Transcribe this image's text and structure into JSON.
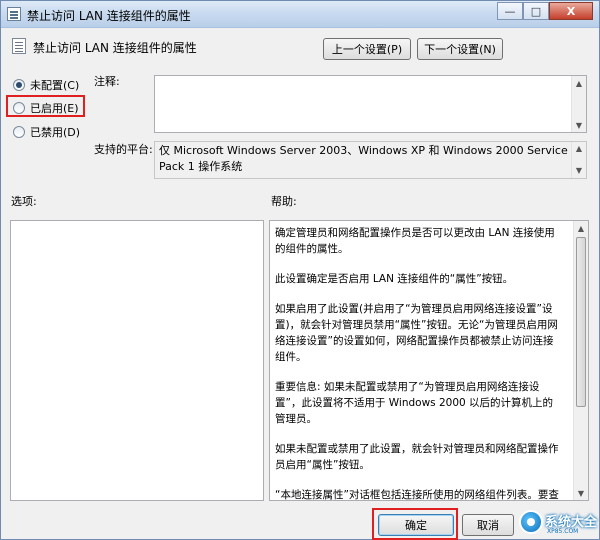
{
  "window": {
    "title": "禁止访问 LAN 连接组件的属性",
    "close_glyph": "X"
  },
  "header": {
    "title": "禁止访问 LAN 连接组件的属性",
    "prev_button": "上一个设置(P)",
    "next_button": "下一个设置(N)"
  },
  "options": {
    "not_configured": "未配置(C)",
    "enabled": "已启用(E)",
    "disabled": "已禁用(D)",
    "selected": "not_configured"
  },
  "comment": {
    "label": "注释:",
    "value": ""
  },
  "platform": {
    "label": "支持的平台:",
    "value": "仅 Microsoft Windows Server 2003、Windows XP 和 Windows 2000 Service Pack 1 操作系统"
  },
  "options_panel": {
    "label": "选项:"
  },
  "help": {
    "label": "帮助:",
    "paragraphs": [
      "确定管理员和网络配置操作员是否可以更改由 LAN 连接使用的组件的属性。",
      "此设置确定是否启用 LAN 连接组件的“属性”按钮。",
      "如果启用了此设置(并启用了“为管理员启用网络连接设置”设置)，就会针对管理员禁用“属性”按钮。无论“为管理员启用网络连接设置”的设置如何，网络配置操作员都被禁止访问连接组件。",
      "重要信息: 如果未配置或禁用了“为管理员启用网络连接设置”，此设置将不适用于 Windows 2000 以后的计算机上的管理员。",
      "如果未配置或禁用了此设置，就会针对管理员和网络配置操作员启用“属性”按钮。",
      "“本地连接属性”对话框包括连接所使用的网络组件列表。要查看或更改组件的属性，请单击组件名称，然后单击组件列表下面的“属性”按钮。"
    ]
  },
  "footer": {
    "ok_button": "确定",
    "cancel_button": "取消"
  },
  "watermark": {
    "text": "系统大全",
    "url": "XP85.COM"
  },
  "colors": {
    "highlight_box": "#e02020",
    "title_bar": "#c7d9ef",
    "dialog_bg": "#f0f0f0"
  }
}
